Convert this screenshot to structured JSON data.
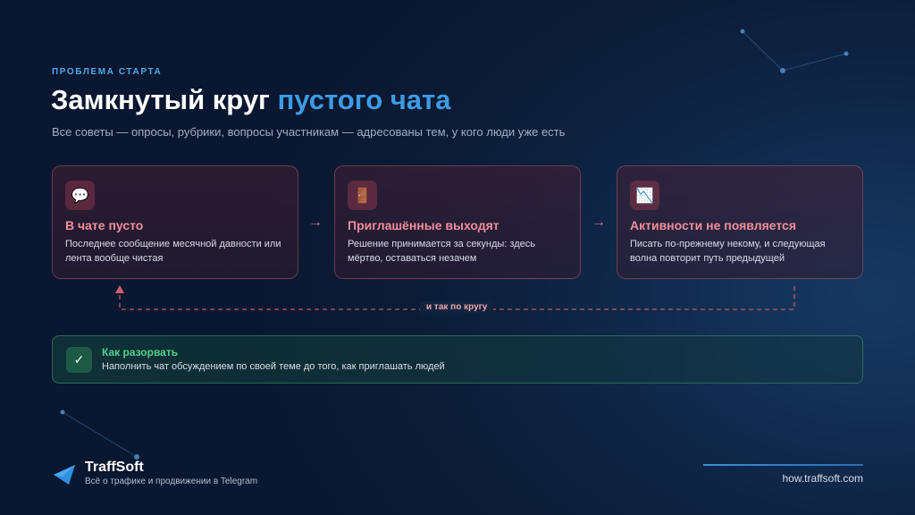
{
  "header": {
    "eyebrow": "ПРОБЛЕМА СТАРТА",
    "title_main": "Замкнутый круг ",
    "title_accent": "пустого чата",
    "subtitle": "Все советы — опросы, рубрики, вопросы участникам — адресованы тем, у кого люди уже есть"
  },
  "cycle": {
    "steps": [
      {
        "icon": "chat-bubble-icon",
        "glyph": "💬",
        "title": "В чате пусто",
        "desc": "Последнее сообщение месячной давности или лента вообще чистая"
      },
      {
        "icon": "door-icon",
        "glyph": "🚪",
        "title": "Приглашённые выходят",
        "desc": "Решение принимается за секунды: здесь мёртво, оставаться незачем"
      },
      {
        "icon": "chart-decreasing-icon",
        "glyph": "📉",
        "title": "Активности не появляется",
        "desc": "Писать по-прежнему некому, и следующая волна повторит путь предыдущей"
      }
    ],
    "arrow_glyph": "→",
    "loop_label": "и так по кругу"
  },
  "solution": {
    "check_glyph": "✓",
    "title": "Как разорвать",
    "desc": "Наполнить чат обсуждением по своей теме до того, как приглашать людей"
  },
  "footer": {
    "brand_name": "TraffSoft",
    "brand_tagline": "Всё о трафике и продвижении в Telegram",
    "url": "how.traffsoft.com"
  },
  "colors": {
    "accent_blue": "#3d9be3",
    "problem_red": "#f08f98",
    "solution_green": "#52d08a"
  }
}
